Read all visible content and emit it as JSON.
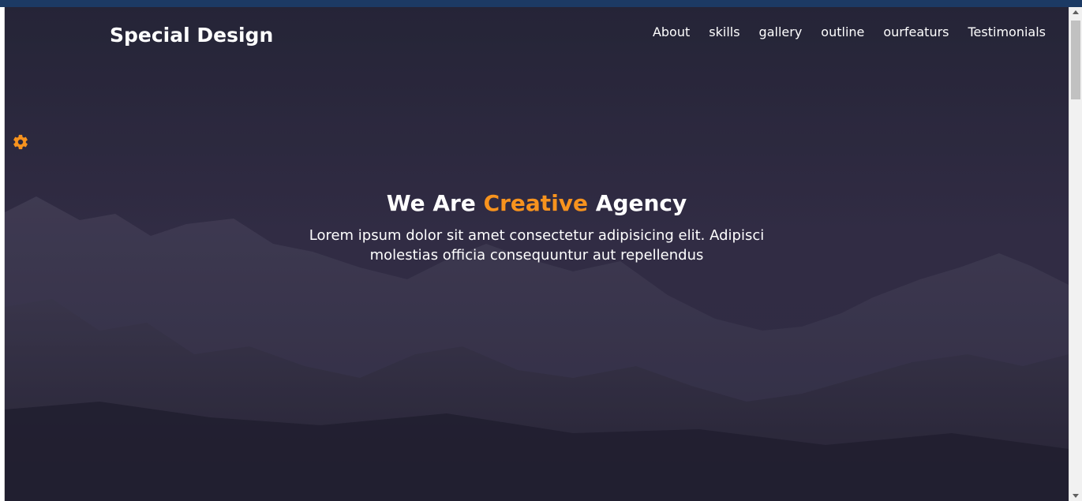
{
  "header": {
    "logo": "Special Design",
    "nav": [
      {
        "label": "About"
      },
      {
        "label": "skills"
      },
      {
        "label": "gallery"
      },
      {
        "label": "outline"
      },
      {
        "label": "ourfeaturs"
      },
      {
        "label": "Testimonials"
      }
    ]
  },
  "hero": {
    "headline_before": "We Are",
    "headline_accent": "Creative",
    "headline_after": "Agency",
    "subtext": "Lorem ipsum dolor sit amet consectetur adipisicing elit. Adipisci molestias officia consequuntur aut repellendus"
  },
  "settings": {
    "icon": "gear-icon"
  },
  "colors": {
    "accent": "#f7931e",
    "top_strip": "#1c3a64",
    "hero_dark": "#2c2a40",
    "text": "#ffffff"
  }
}
